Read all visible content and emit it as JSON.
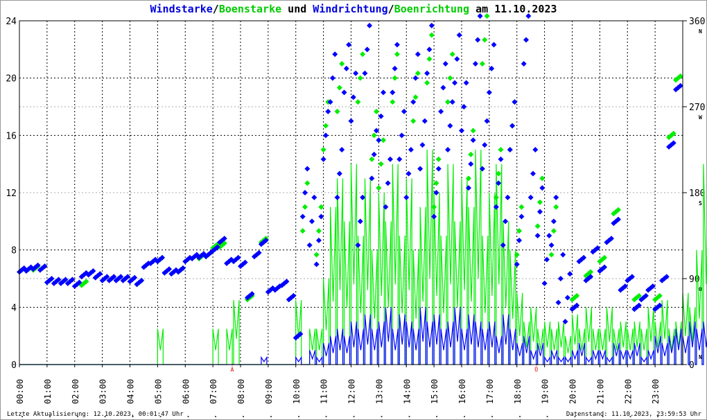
{
  "title": {
    "part1": "Windstarke",
    "sep1": "/",
    "part2": "Boenstarke",
    "mid": " und ",
    "part3": "Windrichtung",
    "sep2": "/",
    "part4": "Boenrichtung",
    "suffix": " am 11.10.2023"
  },
  "footer": {
    "left": "Letzte Aktualisierung: 12.10.2023, 00:01:47 Uhr",
    "right": "Datenstand: 11.10.2023, 23:59:53 Uhr"
  },
  "colors": {
    "wind": "#0000ff",
    "gust": "#00ee00",
    "marker": "#dd0000"
  },
  "chart_data": {
    "type": "line",
    "title": "Windstarke/Boenstarke und Windrichtung/Boenrichtung am 11.10.2023",
    "x_unit": "hours",
    "xlim": [
      0,
      24
    ],
    "x_tick_labels": [
      "11. 00:00",
      "11. 01:00",
      "11. 02:00",
      "11. 03:00",
      "11. 04:00",
      "11. 05:00",
      "11. 06:00",
      "11. 07:00",
      "11. 08:00",
      "11. 09:00",
      "11. 10:00",
      "11. 11:00",
      "11. 12:00",
      "11. 13:00",
      "11. 14:00",
      "11. 15:00",
      "11. 16:00",
      "11. 17:00",
      "11. 18:00",
      "11. 19:00",
      "11. 20:00",
      "11. 21:00",
      "11. 22:00",
      "11. 23:00"
    ],
    "y_left": {
      "ylim": [
        0,
        24
      ],
      "ticks": [
        "0",
        "4",
        "8",
        "12",
        "16",
        "20",
        "24"
      ]
    },
    "y_right": {
      "ylim": [
        0,
        360
      ],
      "ticks": [
        "0",
        "90",
        "180",
        "270",
        "360"
      ],
      "direction_labels": [
        {
          "deg": 0,
          "label": "N"
        },
        {
          "deg": 90,
          "label": "O"
        },
        {
          "deg": 180,
          "label": "S"
        },
        {
          "deg": 270,
          "label": "W"
        },
        {
          "deg": 360,
          "label": "N"
        }
      ]
    },
    "annotations": [
      {
        "hour": 7.7,
        "label": "A"
      },
      {
        "hour": 18.7,
        "label": "U"
      }
    ],
    "grid": true,
    "step_hours": 0.25,
    "series": [
      {
        "name": "Windstarke",
        "kind": "line",
        "color": "#0000ff",
        "values": [
          0,
          0,
          0,
          0,
          0,
          0,
          0,
          0,
          0,
          0,
          0,
          0,
          0,
          0,
          0,
          0,
          0,
          0,
          0,
          0,
          0,
          0,
          0,
          0,
          0,
          0,
          0,
          0,
          0,
          0,
          0,
          0,
          0,
          0,
          0,
          0.5,
          0,
          0,
          0,
          0,
          0.5,
          0,
          1,
          0.5,
          1.5,
          2,
          2.5,
          2,
          3,
          2.5,
          3.5,
          2.5,
          3,
          4,
          2.5,
          3.5,
          3,
          2.5,
          4,
          3,
          3.5,
          2.5,
          3,
          4,
          2.5,
          3.5,
          3,
          2.5,
          3,
          2,
          3.5,
          2.5,
          1.5,
          2,
          1,
          1.5,
          0.5,
          1,
          0.5,
          0.5,
          1,
          1.5,
          0.5,
          1,
          1,
          0.5,
          1.5,
          1,
          1,
          1.5,
          0.5,
          1,
          2,
          1.5,
          2,
          2.5,
          2,
          3,
          2.5,
          3
        ]
      },
      {
        "name": "Boenstarke",
        "kind": "line",
        "color": "#00ee00",
        "values": [
          0,
          0,
          0,
          0,
          0,
          0,
          0,
          0,
          0,
          0,
          0,
          0,
          0,
          0,
          0,
          0,
          0,
          0,
          0,
          0,
          2.5,
          0,
          0,
          0,
          0,
          0,
          0,
          0,
          2.5,
          0,
          2.5,
          4.5,
          0,
          0,
          0,
          0,
          0,
          0,
          0,
          0,
          4.5,
          0,
          2.5,
          2.5,
          6,
          11,
          13,
          10,
          14,
          9,
          13,
          8,
          12,
          10,
          14,
          9,
          13,
          8,
          11,
          15,
          12,
          9,
          14,
          10,
          13,
          11,
          15,
          9,
          12,
          14,
          10,
          8,
          5,
          3,
          4,
          2.5,
          3,
          2.5,
          3,
          2,
          3.5,
          2.5,
          4,
          2.5,
          2.5,
          4,
          2.5,
          3,
          2.5,
          3,
          2.5,
          4,
          3,
          4.5,
          2.5,
          3,
          5,
          4,
          8,
          14
        ]
      },
      {
        "name": "Windrichtung",
        "kind": "scatter",
        "color": "#0000ff",
        "unit": "deg",
        "values": [
          99,
          100,
          102,
          101,
          88,
          87,
          87,
          87,
          84,
          94,
          96,
          93,
          90,
          90,
          90,
          90,
          89,
          86,
          104,
          108,
          110,
          98,
          97,
          99,
          110,
          113,
          114,
          115,
          121,
          130,
          108,
          110,
          105,
          72,
          115,
          128,
          78,
          80,
          85,
          70,
          30,
          180,
          150,
          130,
          240,
          300,
          200,
          310,
          280,
          150,
          330,
          220,
          260,
          190,
          310,
          240,
          200,
          300,
          230,
          330,
          180,
          290,
          250,
          320,
          270,
          210,
          340,
          230,
          310,
          190,
          150,
          250,
          130,
          340,
          200,
          160,
          110,
          150,
          90,
          70,
          60,
          110,
          90,
          120,
          100,
          130,
          150,
          80,
          90,
          60,
          70,
          80,
          60,
          90,
          230,
          290
        ]
      },
      {
        "name": "Boenrichtung",
        "kind": "scatter",
        "color": "#00ee00",
        "unit": "deg",
        "values": [
          null,
          null,
          101,
          null,
          null,
          null,
          null,
          null,
          null,
          85,
          null,
          null,
          null,
          null,
          null,
          null,
          null,
          86,
          null,
          null,
          110,
          null,
          null,
          99,
          null,
          null,
          113,
          null,
          124,
          125,
          null,
          null,
          null,
          70,
          null,
          130,
          null,
          null,
          null,
          null,
          null,
          165,
          null,
          140,
          250,
          null,
          290,
          null,
          null,
          300,
          null,
          240,
          210,
          null,
          300,
          null,
          null,
          280,
          null,
          320,
          190,
          null,
          300,
          null,
          null,
          220,
          null,
          340,
          null,
          200,
          null,
          250,
          140,
          null,
          null,
          170,
          null,
          140,
          null,
          null,
          70,
          null,
          95,
          null,
          110,
          null,
          160,
          null,
          null,
          70,
          null,
          null,
          70,
          null,
          240,
          300
        ]
      }
    ]
  }
}
